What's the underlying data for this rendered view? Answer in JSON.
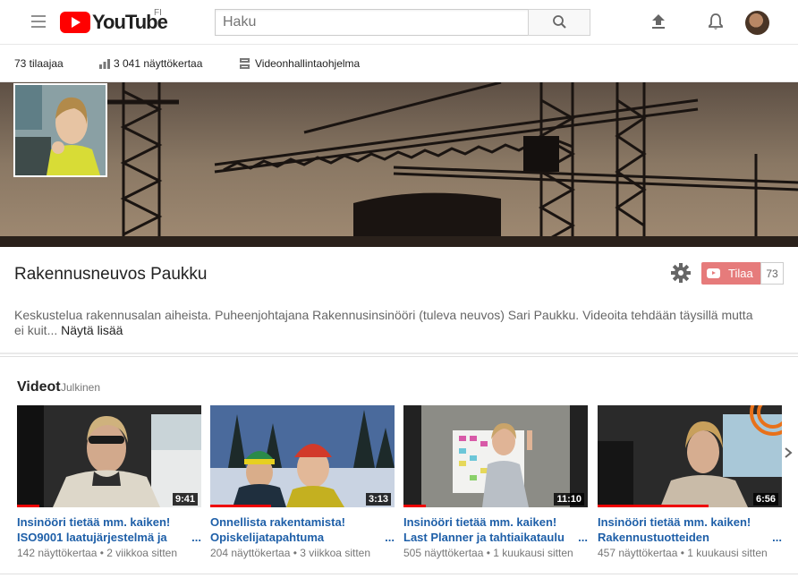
{
  "header": {
    "logo_text": "YouTube",
    "country_code": "FI",
    "search_placeholder": "Haku",
    "icons": [
      "menu-icon",
      "search-icon",
      "upload-icon",
      "bell-icon",
      "avatar"
    ]
  },
  "stats": {
    "subscribers": "73 tilaajaa",
    "views": "3 041 näyttökertaa",
    "studio": "Videonhallintaohjelma"
  },
  "channel": {
    "name": "Rakennusneuvos Paukku",
    "subscribe_label": "Tilaa",
    "subscribe_count": "73",
    "description": "Keskustelua rakennusalan aiheista. Puheenjohtajana Rakennusinsinööri (tuleva neuvos) Sari Paukku. Videoita tehdään täysillä mutta ei kuit...",
    "show_more": "Näytä lisää"
  },
  "videos_section": {
    "title": "Videot",
    "badge": "Julkinen",
    "items": [
      {
        "title": "Insinööri tietää mm. kaiken! ISO9001 laatujärjestelmä ja",
        "ellipsis": "...",
        "views": "142 näyttökertaa",
        "sep": "•",
        "age": "2 viikkoa sitten",
        "duration": "9:41",
        "progress": 0.12
      },
      {
        "title": "Onnellista rakentamista! Opiskelijatapahtuma",
        "ellipsis": "...",
        "views": "204 näyttökertaa",
        "sep": "•",
        "age": "3 viikkoa sitten",
        "duration": "3:13",
        "progress": 0.33
      },
      {
        "title": "Insinööri tietää mm. kaiken! Last Planner ja tahtiaikataulu",
        "ellipsis": "...",
        "views": "505 näyttökertaa",
        "sep": "•",
        "age": "1 kuukausi sitten",
        "duration": "11:10",
        "progress": 0.12
      },
      {
        "title": "Insinööri tietää mm. kaiken! Rakennustuotteiden",
        "ellipsis": "...",
        "views": "457 näyttökertaa",
        "sep": "•",
        "age": "1 kuukausi sitten",
        "duration": "6:56",
        "progress": 0.6
      }
    ]
  },
  "colors": {
    "brand_red": "#ff0000",
    "subscribe_bg": "#e67b7b",
    "link_blue": "#1e5fa8"
  }
}
